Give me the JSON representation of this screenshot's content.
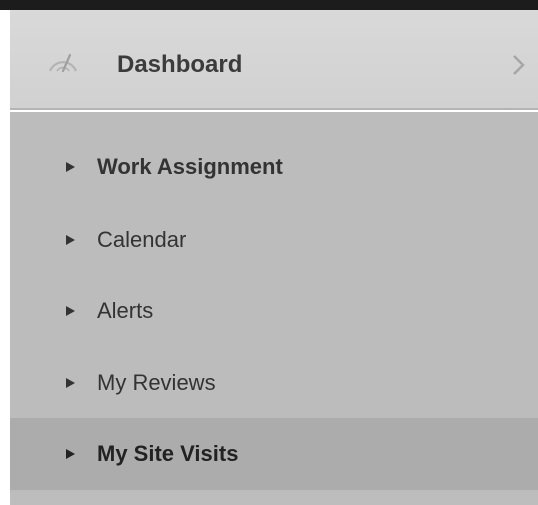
{
  "header": {
    "title": "Dashboard",
    "icon": "speedometer-icon",
    "chevron_icon": "chevron-right-icon"
  },
  "menu": {
    "bullet_icon": "triangle-right-icon",
    "items": [
      {
        "label": "Work Assignment",
        "active": false
      },
      {
        "label": "Calendar",
        "active": false
      },
      {
        "label": "Alerts",
        "active": false
      },
      {
        "label": "My Reviews",
        "active": false
      },
      {
        "label": "My Site Visits",
        "active": true
      }
    ]
  },
  "colors": {
    "header_bg": "#d6d6d6",
    "submenu_bg": "#bcbcbc",
    "active_item_bg": "#acacac",
    "text": "#333333",
    "top_bar": "#1c1c1c"
  }
}
